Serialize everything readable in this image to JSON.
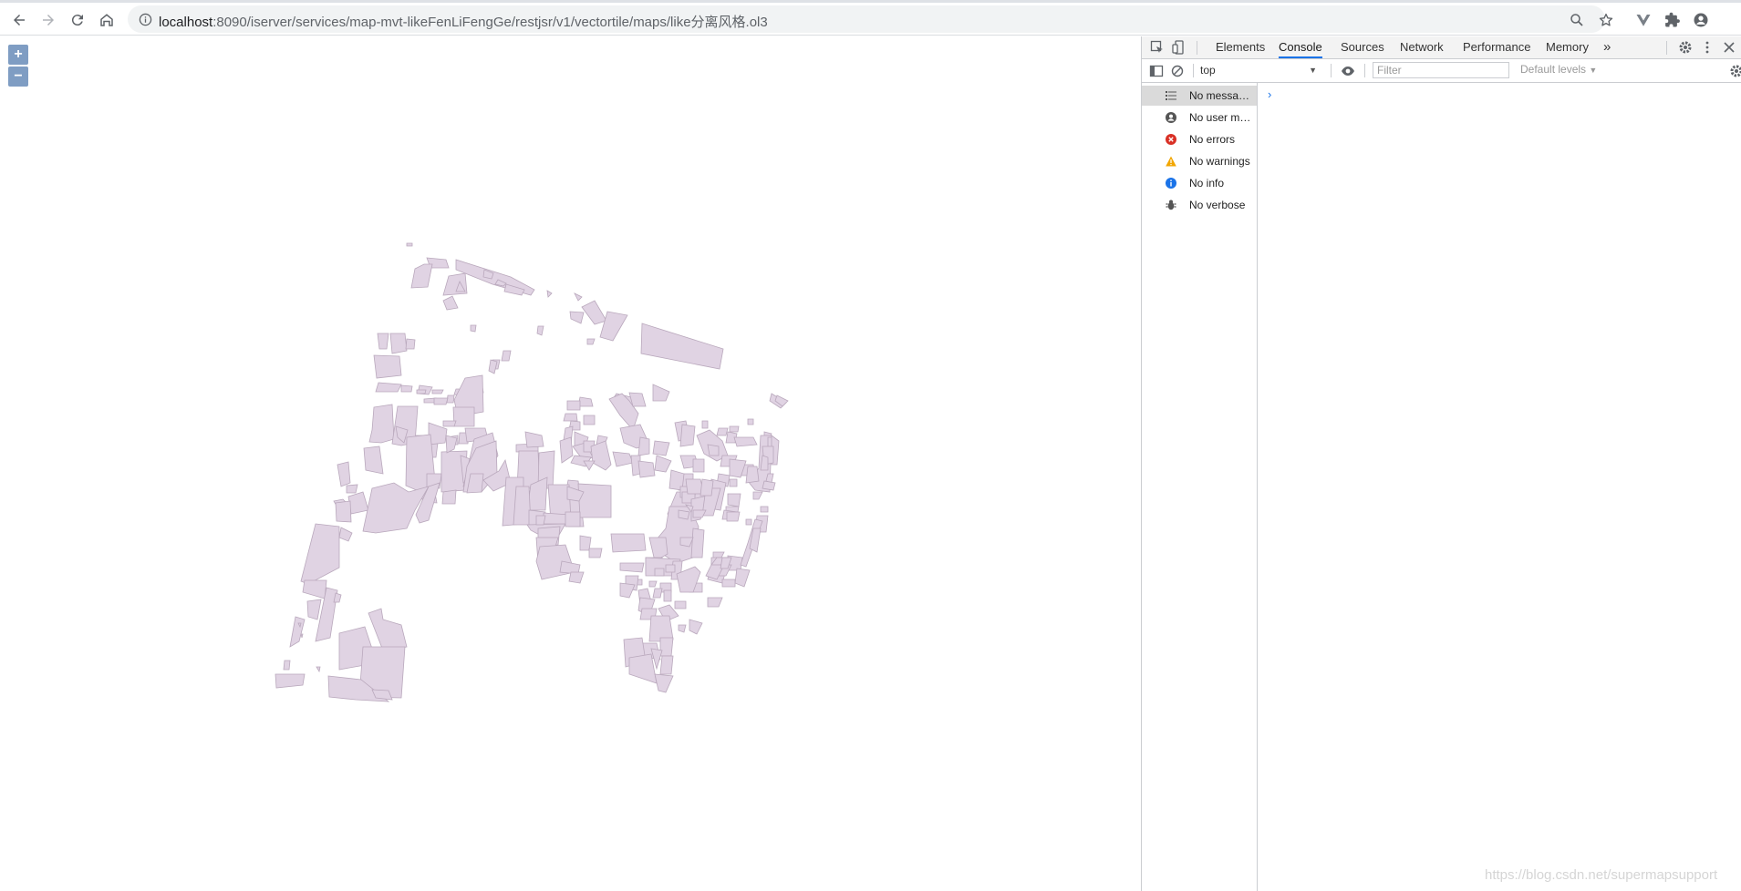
{
  "browser": {
    "url_host": "localhost",
    "url_rest": ":8090/iserver/services/map-mvt-likeFenLiFengGe/restjsr/v1/vectortile/maps/like分离风格.ol3",
    "icons": [
      "back-icon",
      "forward-icon",
      "reload-icon",
      "home-icon",
      "info-icon",
      "zoom-icon",
      "star-icon",
      "vue-devtools-icon",
      "extensions-icon",
      "profile-icon"
    ]
  },
  "map": {
    "zoom_in_label": "+",
    "zoom_out_label": "−",
    "polygon_fill": "#e0d3e3",
    "polygon_stroke": "#b9a8bc"
  },
  "watermark": "https://blog.csdn.net/supermapsupport",
  "devtools": {
    "tabs": [
      {
        "label": "Elements"
      },
      {
        "label": "Console"
      },
      {
        "label": "Sources"
      },
      {
        "label": "Network"
      },
      {
        "label": "Performance"
      },
      {
        "label": "Memory"
      }
    ],
    "more_tabs_label": "»",
    "context": "top",
    "filter_placeholder": "Filter",
    "levels_label": "Default levels",
    "prompt": "›",
    "sidebar": [
      {
        "label": "No messages",
        "icon": "list-icon"
      },
      {
        "label": "No user messages",
        "icon": "user-icon"
      },
      {
        "label": "No errors",
        "icon": "error-icon",
        "color": "#d93025"
      },
      {
        "label": "No warnings",
        "icon": "warning-icon",
        "color": "#f2a600"
      },
      {
        "label": "No info",
        "icon": "info-icon",
        "color": "#1a73e8"
      },
      {
        "label": "No verbose",
        "icon": "bug-icon"
      }
    ]
  }
}
